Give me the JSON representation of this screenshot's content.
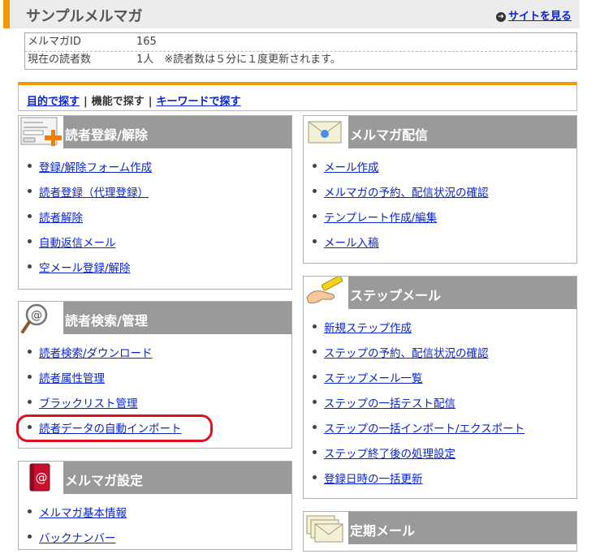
{
  "header": {
    "title": "サンプルメルマガ",
    "site_link": "サイトを見る"
  },
  "info": {
    "id_label": "メルマガID",
    "id_value": "165",
    "readers_label": "現在の読者数",
    "readers_value": "1人　※読者数は５分に１度更新されます。"
  },
  "nav": {
    "purpose": "目的で探す",
    "function": "機能で探す",
    "keyword": "キーワードで探す",
    "separator": "|"
  },
  "panels": {
    "reader_reg": {
      "title": "読者登録/解除",
      "items": [
        "登録/解除フォーム作成",
        "読者登録（代理登録）",
        "読者解除",
        "自動返信メール",
        "空メール登録/解除"
      ]
    },
    "reader_search": {
      "title": "読者検索/管理",
      "items": [
        "読者検索/ダウンロード",
        "読者属性管理",
        "ブラックリスト管理",
        "読者データの自動インポート"
      ]
    },
    "mag_settings": {
      "title": "メルマガ設定",
      "items": [
        "メルマガ基本情報",
        "バックナンバー"
      ]
    },
    "delivery": {
      "title": "メルマガ配信",
      "items": [
        "メール作成",
        "メルマガの予約、配信状況の確認",
        "テンプレート作成/編集",
        "メール入稿"
      ]
    },
    "step": {
      "title": "ステップメール",
      "items": [
        "新規ステップ作成",
        "ステップの予約、配信状況の確認",
        "ステップメール一覧",
        "ステップの一括テスト配信",
        "ステップの一括インポート/エクスポート",
        "ステップ終了後の処理設定",
        "登録日時の一括更新"
      ]
    },
    "periodic": {
      "title": "定期メール"
    }
  }
}
